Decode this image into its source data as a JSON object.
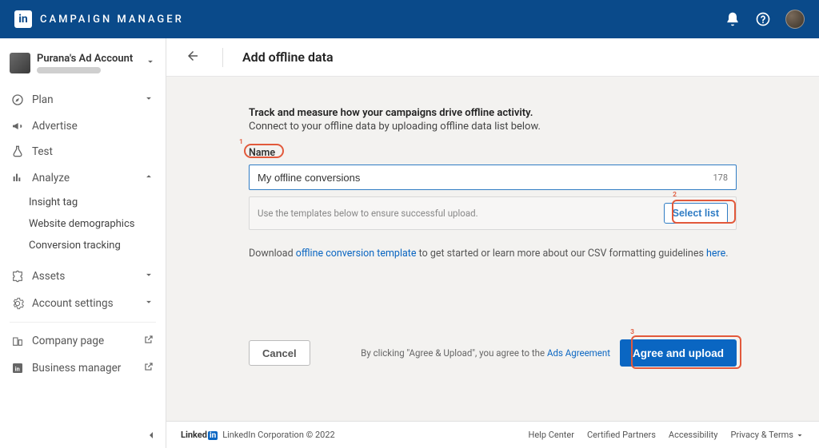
{
  "header": {
    "app_name": "CAMPAIGN MANAGER",
    "logo_text": "in"
  },
  "account": {
    "name": "Purana's Ad Account"
  },
  "sidebar": {
    "items": [
      {
        "label": "Plan",
        "icon": "compass"
      },
      {
        "label": "Advertise",
        "icon": "megaphone"
      },
      {
        "label": "Test",
        "icon": "flask"
      },
      {
        "label": "Analyze",
        "icon": "bar-chart",
        "expanded": true
      },
      {
        "label": "Assets",
        "icon": "puzzle"
      },
      {
        "label": "Account settings",
        "icon": "gear"
      },
      {
        "label": "Company page",
        "icon": "external"
      },
      {
        "label": "Business manager",
        "icon": "linkedin"
      }
    ],
    "analyze_sub": [
      "Insight tag",
      "Website demographics",
      "Conversion tracking"
    ]
  },
  "page": {
    "title": "Add offline data",
    "intro_bold": "Track and measure how your campaigns drive offline activity.",
    "intro_sub": "Connect to your offline data by uploading offline data list below.",
    "name_label": "Name",
    "name_value": "My offline conversions",
    "char_count": "178",
    "upload_hint": "Use the templates below to ensure successful upload.",
    "select_list_label": "Select list",
    "download_pre": "Download ",
    "download_link": "offline conversion template",
    "download_mid": " to get started or learn more about our CSV formatting guidelines ",
    "download_here": "here",
    "download_post": "."
  },
  "actions": {
    "cancel": "Cancel",
    "agree_pre": "By clicking \"Agree & Upload\", you agree to the ",
    "ads_agreement": "Ads Agreement",
    "agree_upload": "Agree and upload"
  },
  "annotations": {
    "n1": "1",
    "n2": "2",
    "n3": "3"
  },
  "footer": {
    "linkedin": "Linked",
    "corp": "LinkedIn Corporation © 2022",
    "links": [
      "Help Center",
      "Certified Partners",
      "Accessibility",
      "Privacy & Terms"
    ]
  }
}
